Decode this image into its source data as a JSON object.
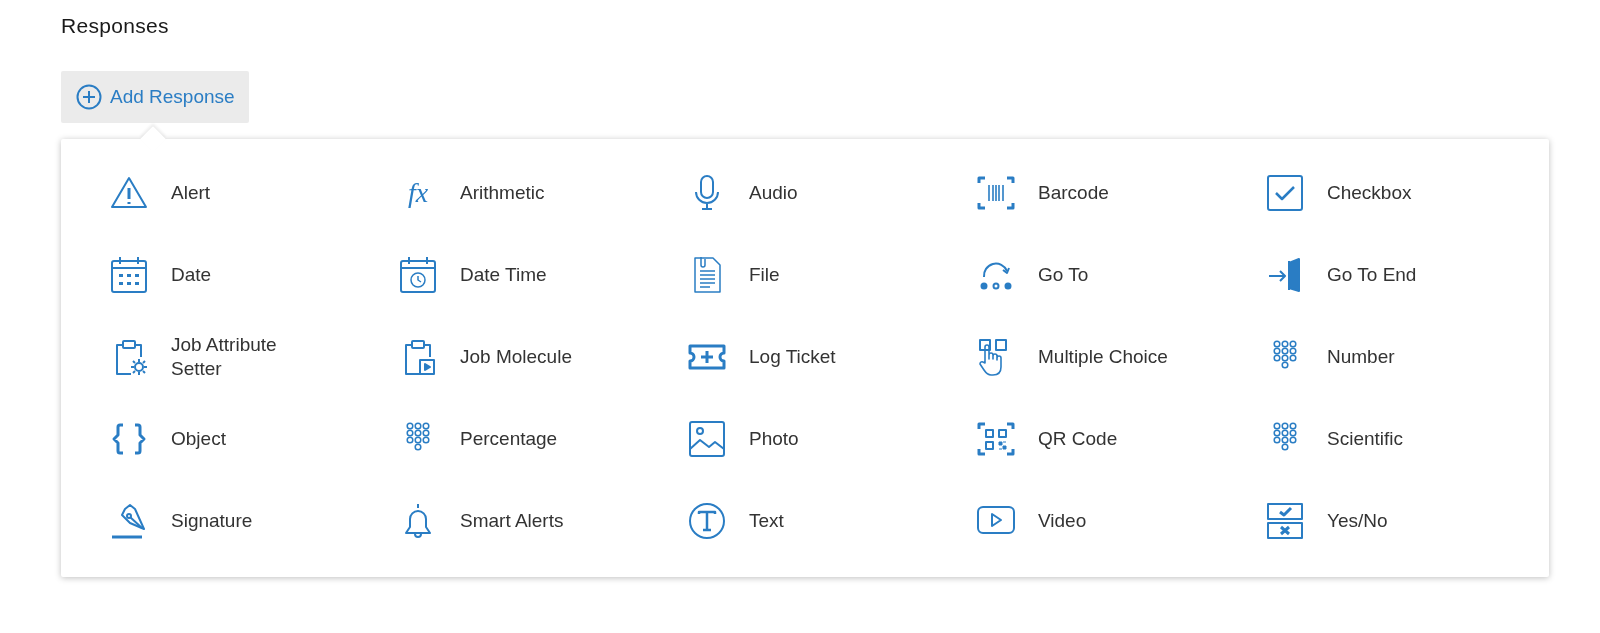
{
  "title": "Responses",
  "add_button": {
    "label": "Add Response"
  },
  "items": [
    {
      "label": "Alert",
      "kind": "alert"
    },
    {
      "label": "Arithmetic",
      "kind": "formula",
      "glyph": "fx"
    },
    {
      "label": "Audio",
      "kind": "audio"
    },
    {
      "label": "Barcode",
      "kind": "barcode"
    },
    {
      "label": "Checkbox",
      "kind": "checkbox"
    },
    {
      "label": "Date",
      "kind": "date"
    },
    {
      "label": "Date Time",
      "kind": "datetime"
    },
    {
      "label": "File",
      "kind": "file"
    },
    {
      "label": "Go To",
      "kind": "goto"
    },
    {
      "label": "Go To End",
      "kind": "end"
    },
    {
      "label": "Job Attribute Setter",
      "kind": "attribute"
    },
    {
      "label": "Job Molecule",
      "kind": "molecule"
    },
    {
      "label": "Log Ticket",
      "kind": "ticket"
    },
    {
      "label": "Multiple Choice",
      "kind": "choice"
    },
    {
      "label": "Number",
      "kind": "keypad"
    },
    {
      "label": "Object",
      "kind": "object"
    },
    {
      "label": "Percentage",
      "kind": "keypad"
    },
    {
      "label": "Photo",
      "kind": "photo"
    },
    {
      "label": "QR Code",
      "kind": "qr"
    },
    {
      "label": "Scientific",
      "kind": "keypad"
    },
    {
      "label": "Signature",
      "kind": "signature"
    },
    {
      "label": "Smart Alerts",
      "kind": "bell"
    },
    {
      "label": "Text",
      "kind": "text"
    },
    {
      "label": "Video",
      "kind": "video"
    },
    {
      "label": "Yes/No",
      "kind": "yesno"
    }
  ]
}
